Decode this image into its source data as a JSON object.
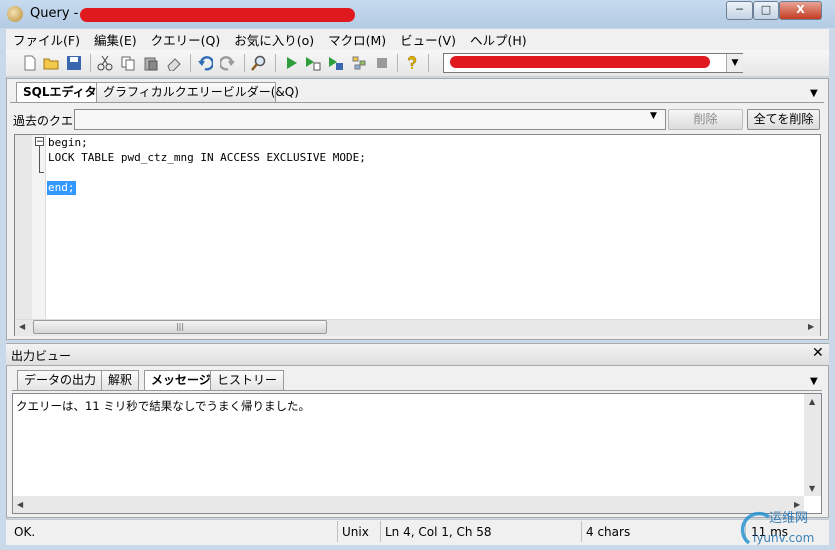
{
  "window": {
    "title": "Query - ",
    "controls": {
      "minimize": "─",
      "maximize": "□",
      "close": "X"
    }
  },
  "menu": [
    {
      "label": "ファイル(F)"
    },
    {
      "label": "編集(E)"
    },
    {
      "label": "クエリー(Q)"
    },
    {
      "label": "お気に入り(o)"
    },
    {
      "label": "マクロ(M)"
    },
    {
      "label": "ビュー(V)"
    },
    {
      "label": "ヘルプ(H)"
    }
  ],
  "toolbar": {
    "icons": [
      "new-file-icon",
      "open-folder-icon",
      "save-icon",
      "cut-icon",
      "copy-icon",
      "paste-icon",
      "clear-icon",
      "undo-icon",
      "redo-icon",
      "find-icon",
      "execute-icon",
      "execute-script-icon",
      "execute-step-icon",
      "explain-icon",
      "stop-icon",
      "help-icon"
    ]
  },
  "editor_tabs": [
    {
      "label": "SQLエディタ",
      "active": true
    },
    {
      "label": "グラフィカルクエリービルダー(&Q)",
      "active": false
    }
  ],
  "history": {
    "label": "過去のクエリ",
    "value": "",
    "delete_label": "削除",
    "delete_all_label": "全てを削除"
  },
  "editor": {
    "lines": [
      "begin;",
      "LOCK TABLE pwd_ctz_mng IN ACCESS EXCLUSIVE MODE;",
      "",
      "end;"
    ],
    "selected_text": "end;"
  },
  "output": {
    "title": "出力ビュー",
    "close": "✕",
    "tabs": [
      {
        "label": "データの出力",
        "active": false
      },
      {
        "label": "解釈",
        "active": false
      },
      {
        "label": "メッセージ",
        "active": true
      },
      {
        "label": "ヒストリー",
        "active": false
      }
    ],
    "message": "クエリーは、11 ミリ秒で結果なしでうまく帰りました。"
  },
  "status": {
    "state": "OK.",
    "line_ending": "Unix",
    "position": "Ln 4, Col 1, Ch 58",
    "chars": "4 chars",
    "time": "11 ms"
  },
  "watermark": {
    "text": "运维网",
    "sub": "iyunv.com"
  },
  "colors": {
    "redaction": "#e0191f",
    "selection": "#3399ff",
    "titlebar": "#b9cfe6"
  }
}
